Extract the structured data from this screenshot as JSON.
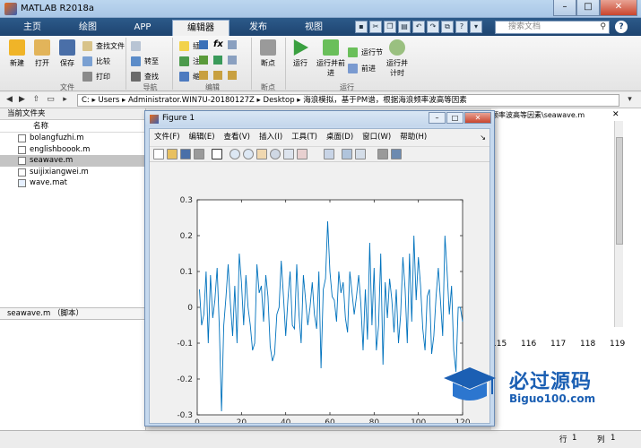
{
  "window": {
    "title": "MATLAB R2018a"
  },
  "tabs": [
    {
      "label": "主页"
    },
    {
      "label": "绘图"
    },
    {
      "label": "APP"
    },
    {
      "label": "编辑器"
    },
    {
      "label": "发布"
    },
    {
      "label": "视图"
    }
  ],
  "search": {
    "placeholder": "搜索文档"
  },
  "ribbon": {
    "file": {
      "group": "文件",
      "new": "新建",
      "open": "打开",
      "save": "保存",
      "find_files": "查找文件",
      "compare": "比较",
      "print": "打印"
    },
    "navigate": {
      "group": "导航",
      "goto": "转至",
      "find": "查找"
    },
    "edit": {
      "group": "编辑",
      "insert": "插入",
      "comment": "注释",
      "indent": "缩进",
      "fx": "fx"
    },
    "breakpoints": {
      "group": "断点",
      "label": "断点"
    },
    "run": {
      "group": "运行",
      "run": "运行",
      "run_advance": "运行并前进",
      "run_section": "运行节",
      "advance": "前进",
      "run_time": "运行并计时"
    }
  },
  "address": {
    "path": "C: ▸ Users ▸ Administrator.WIN7U-20180127Z ▸ Desktop ▸ 海浪模拟，基于PM谱，根据海浪频率波高等因素"
  },
  "current_folder": {
    "header": "当前文件夹",
    "column_name": "名称",
    "files": [
      {
        "name": "bolangfuzhi.m",
        "selected": false
      },
      {
        "name": "englishboook.m",
        "selected": false
      },
      {
        "name": "seawave.m",
        "selected": true
      },
      {
        "name": "suijixiangwei.m",
        "selected": false
      },
      {
        "name": "wave.mat",
        "selected": false
      }
    ],
    "detail": "seawave.m （脚本）"
  },
  "editor": {
    "tab_label": "频率波高等因素\\seawave.m"
  },
  "command": {
    "columns": [
      "115",
      "116",
      "117",
      "118",
      "119"
    ]
  },
  "status": {
    "row_label": "行",
    "row_value": "1",
    "col_label": "列",
    "col_value": "1"
  },
  "figure": {
    "title": "Figure 1",
    "menu": [
      "文件(F)",
      "编辑(E)",
      "查看(V)",
      "插入(I)",
      "工具(T)",
      "桌面(D)",
      "窗口(W)",
      "帮助(H)"
    ]
  },
  "watermark": {
    "brand": "必过源码",
    "url": "Biguo100.com"
  },
  "chart_data": {
    "type": "line",
    "title": "",
    "xlabel": "",
    "ylabel": "",
    "xlim": [
      0,
      120
    ],
    "ylim": [
      -0.3,
      0.3
    ],
    "xticks": [
      0,
      20,
      40,
      60,
      80,
      100,
      120
    ],
    "yticks": [
      -0.3,
      -0.2,
      -0.1,
      0,
      0.1,
      0.2,
      0.3
    ],
    "grid": false,
    "color": "#0072BD",
    "series": [
      {
        "x": [
          1,
          2,
          3,
          4,
          5,
          6,
          7,
          8,
          9,
          10,
          11,
          12,
          13,
          14,
          15,
          16,
          17,
          18,
          19,
          20,
          21,
          22,
          23,
          24,
          25,
          26,
          27,
          28,
          29,
          30,
          31,
          32,
          33,
          34,
          35,
          36,
          37,
          38,
          39,
          40,
          41,
          42,
          43,
          44,
          45,
          46,
          47,
          48,
          49,
          50,
          51,
          52,
          53,
          54,
          55,
          56,
          57,
          58,
          59,
          60,
          61,
          62,
          63,
          64,
          65,
          66,
          67,
          68,
          69,
          70,
          71,
          72,
          73,
          74,
          75,
          76,
          77,
          78,
          79,
          80,
          81,
          82,
          83,
          84,
          85,
          86,
          87,
          88,
          89,
          90,
          91,
          92,
          93,
          94,
          95,
          96,
          97,
          98,
          99,
          100,
          101,
          102,
          103,
          104,
          105,
          106,
          107,
          108,
          109,
          110,
          111,
          112,
          113,
          114,
          115,
          116,
          117,
          118,
          119,
          120
        ],
        "y": [
          0.05,
          -0.05,
          -0.02,
          0.1,
          -0.1,
          0.09,
          -0.03,
          0.02,
          0.11,
          -0.06,
          -0.29,
          -0.05,
          0.03,
          0.12,
          0.01,
          -0.08,
          0.06,
          -0.1,
          0.15,
          0.07,
          -0.05,
          0.09,
          0.0,
          -0.05,
          -0.12,
          -0.1,
          0.12,
          0.04,
          0.06,
          -0.04,
          0.09,
          0.03,
          -0.11,
          -0.15,
          -0.13,
          -0.02,
          0.0,
          0.13,
          0.03,
          -0.08,
          0.02,
          0.1,
          -0.05,
          -0.06,
          0.12,
          -0.02,
          -0.1,
          0.09,
          0.02,
          -0.05,
          0.0,
          0.07,
          -0.02,
          -0.06,
          0.1,
          -0.17,
          0.05,
          0.08,
          0.24,
          0.1,
          0.03,
          0.02,
          -0.04,
          0.1,
          0.04,
          0.07,
          -0.03,
          -0.07,
          0.1,
          0.04,
          -0.02,
          0.03,
          0.09,
          0.01,
          -0.12,
          0.05,
          -0.09,
          0.18,
          -0.05,
          0.11,
          -0.12,
          -0.05,
          0.15,
          -0.16,
          0.07,
          -0.03,
          0.08,
          0.02,
          -0.07,
          0.05,
          -0.1,
          -0.02,
          0.14,
          0.05,
          -0.1,
          0.15,
          -0.04,
          0.2,
          0.02,
          0.14,
          0.06,
          -0.06,
          -0.12,
          0.03,
          0.05,
          -0.13,
          -0.08,
          0.03,
          0.11,
          0.02,
          -0.08,
          0.2,
          0.1,
          -0.02,
          0.06,
          -0.12,
          -0.18,
          0.0,
          0.0,
          -0.04
        ]
      }
    ]
  }
}
